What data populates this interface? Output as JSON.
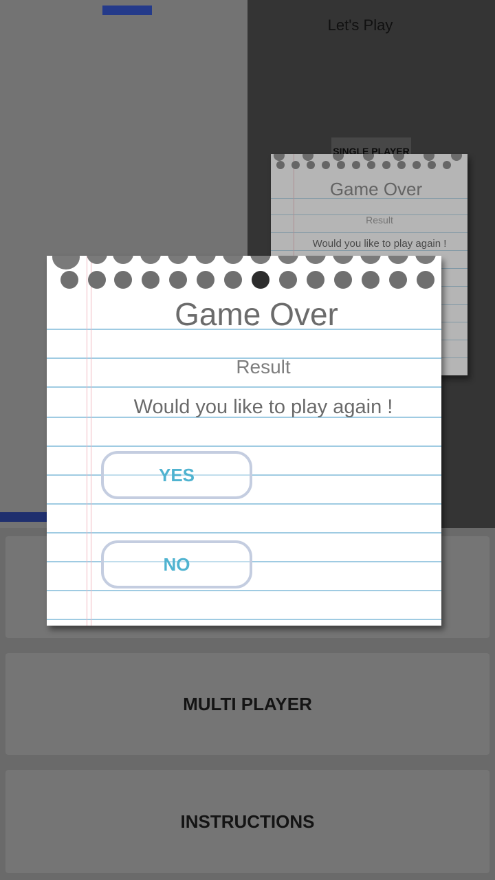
{
  "background": {
    "header_title": "Let's Play",
    "menu": {
      "single_player": "SINGLE PLAYER",
      "multi_player": "MULTI PLAYER",
      "instructions": "INSTRUCTIONS"
    }
  },
  "back_dialog": {
    "title": "Game Over",
    "result": "Result",
    "question": "Would you like to play again !"
  },
  "dialog": {
    "title": "Game Over",
    "result": "Result",
    "question": "Would you like to play again !",
    "yes_label": "YES",
    "no_label": "NO"
  },
  "colors": {
    "accent_text": "#4fb3d0",
    "button_border": "#c4cde0",
    "paper_line": "#9fcbe2"
  }
}
